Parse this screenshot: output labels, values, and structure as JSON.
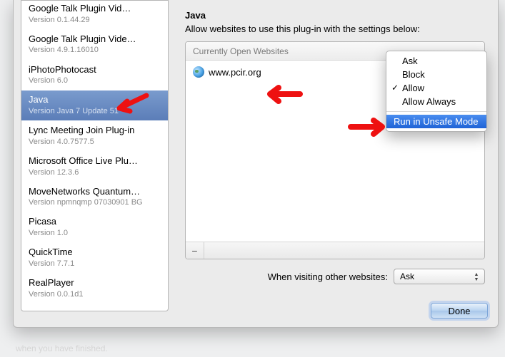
{
  "sidebar": {
    "items": [
      {
        "name": "Google Talk Plugin Vid…",
        "version": "Version 0.1.44.29"
      },
      {
        "name": "Google Talk Plugin Vide…",
        "version": "Version 4.9.1.16010"
      },
      {
        "name": "iPhotoPhotocast",
        "version": "Version 6.0"
      },
      {
        "name": "Java",
        "version": "Version Java 7 Update 51"
      },
      {
        "name": "Lync Meeting Join Plug-in",
        "version": "Version 4.0.7577.5"
      },
      {
        "name": "Microsoft Office Live Plu…",
        "version": "Version 12.3.6"
      },
      {
        "name": "MoveNetworks Quantum…",
        "version": "Version npmnqmp 07030901 BG"
      },
      {
        "name": "Picasa",
        "version": "Version 1.0"
      },
      {
        "name": "QuickTime",
        "version": "Version 7.7.1"
      },
      {
        "name": "RealPlayer",
        "version": "Version 0.0.1d1"
      }
    ],
    "selected_index": 3
  },
  "content": {
    "title": "Java",
    "description": "Allow websites to use this plug-in with the settings below:",
    "panel_header": "Currently Open Websites",
    "sites": [
      {
        "name": "www.pcir.org"
      }
    ],
    "other_label": "When visiting other websites:",
    "other_value": "Ask"
  },
  "menu": {
    "items": [
      {
        "label": "Ask",
        "checked": false
      },
      {
        "label": "Block",
        "checked": false
      },
      {
        "label": "Allow",
        "checked": true
      },
      {
        "label": "Allow Always",
        "checked": false
      }
    ],
    "highlighted": "Run in Unsafe Mode"
  },
  "buttons": {
    "done": "Done",
    "remove_site": "−"
  }
}
